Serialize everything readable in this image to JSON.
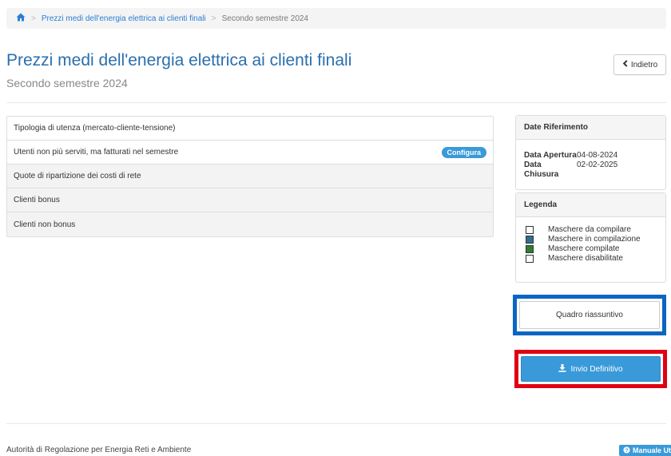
{
  "breadcrumb": {
    "home_icon": "home-icon",
    "link": "Prezzi medi dell'energia elettrica ai clienti finali",
    "current": "Secondo semestre 2024",
    "separator": ">"
  },
  "header": {
    "title": "Prezzi medi dell'energia elettrica ai clienti finali",
    "subtitle": "Secondo semestre 2024",
    "back_label": "Indietro",
    "back_icon": "chevron-left-icon"
  },
  "list": {
    "items": [
      {
        "label": "Tipologia di utenza (mercato-cliente-tensione)"
      },
      {
        "label": "Utenti non più serviti, ma fatturati nel semestre",
        "badge": "Configura"
      },
      {
        "label": "Quote di ripartizione dei costi di rete"
      },
      {
        "label": "Clienti bonus"
      },
      {
        "label": "Clienti non bonus"
      }
    ]
  },
  "dates": {
    "title": "Date Riferimento",
    "opening_label": "Data Apertura",
    "opening_value": "04-08-2024",
    "closing_label": "Data Chiusura",
    "closing_value": "02-02-2025"
  },
  "legend": {
    "title": "Legenda",
    "items": [
      {
        "label": "Maschere da compilare",
        "color": "#ffffff"
      },
      {
        "label": "Maschere in compilazione",
        "color": "#2f6f91"
      },
      {
        "label": "Maschere compilate",
        "color": "#2e7d32"
      },
      {
        "label": "Maschere disabilitate",
        "color": "#ffffff"
      }
    ]
  },
  "actions": {
    "summary_label": "Quadro riassuntivo",
    "submit_label": "Invio Definitivo",
    "submit_icon": "download-icon"
  },
  "footer": {
    "text": "Autorità di Regolazione per Energia Reti e Ambiente",
    "manual_label": "Manuale Ute",
    "manual_icon": "question-circle-icon"
  },
  "colors": {
    "primary": "#3a9ad9",
    "title": "#2a6fae",
    "highlight_blue": "#0a66c2",
    "highlight_red": "#e00012"
  }
}
